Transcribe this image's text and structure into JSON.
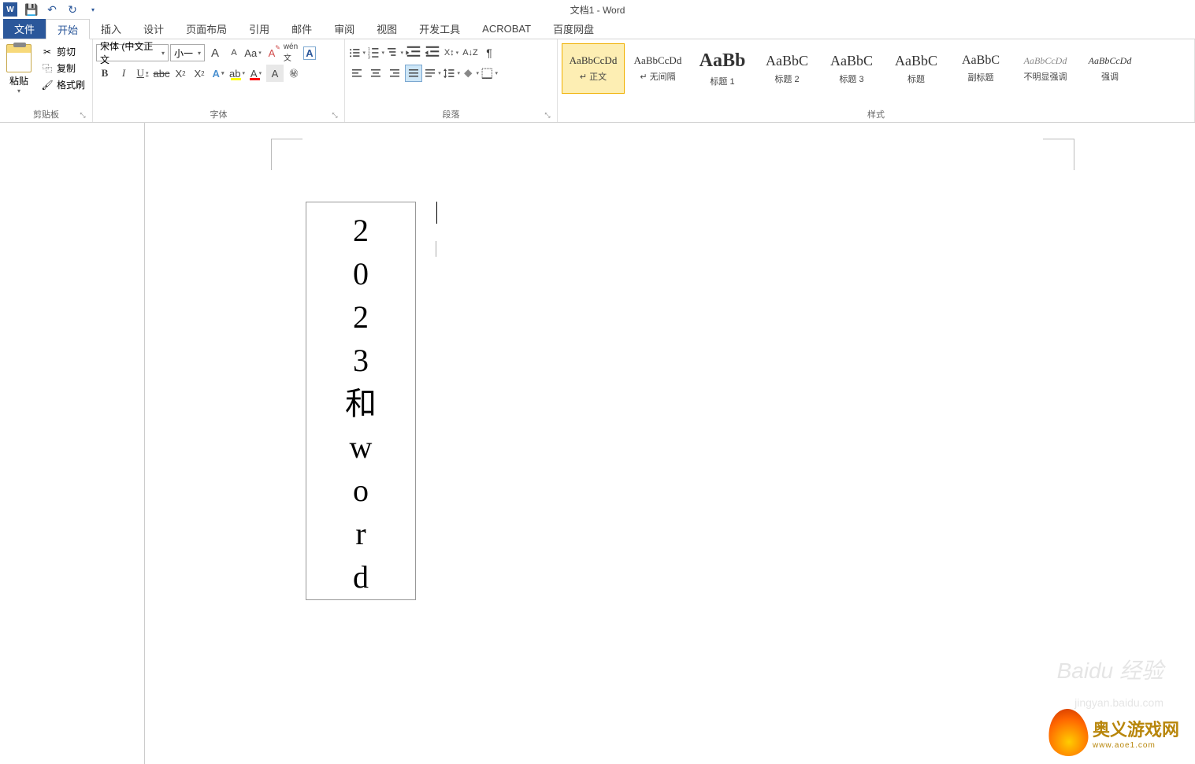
{
  "title": "文档1 - Word",
  "qat": {
    "save_icon": "💾",
    "undo_icon": "↶",
    "redo_icon": "↻"
  },
  "tabs": {
    "file": "文件",
    "items": [
      "开始",
      "插入",
      "设计",
      "页面布局",
      "引用",
      "邮件",
      "审阅",
      "视图",
      "开发工具",
      "ACROBAT",
      "百度网盘"
    ],
    "active": 0
  },
  "clipboard": {
    "paste": "粘贴",
    "cut": "剪切",
    "copy": "复制",
    "format_painter": "格式刷",
    "group_label": "剪贴板"
  },
  "font": {
    "name": "宋体 (中文正文",
    "size": "小一",
    "group_label": "字体",
    "grow": "A",
    "shrink": "A",
    "case": "Aa",
    "clear": "A",
    "phonetic": "拼",
    "border_char": "A",
    "bold": "B",
    "italic": "I",
    "underline": "U",
    "strike": "abc",
    "sub_x": "X",
    "sup_x": "X",
    "effects": "A",
    "highlight": "ab",
    "font_color": "A",
    "char_shading": "A",
    "enclose": "包"
  },
  "paragraph": {
    "group_label": "段落"
  },
  "styles": {
    "group_label": "样式",
    "items": [
      {
        "preview": "AaBbCcDd",
        "name": "↵ 正文",
        "size": "13px",
        "selected": true
      },
      {
        "preview": "AaBbCcDd",
        "name": "↵ 无间隔",
        "size": "13px"
      },
      {
        "preview": "AaBb",
        "name": "标题 1",
        "size": "24px",
        "weight": "bold"
      },
      {
        "preview": "AaBbC",
        "name": "标题 2",
        "size": "18px"
      },
      {
        "preview": "AaBbC",
        "name": "标题 3",
        "size": "18px"
      },
      {
        "preview": "AaBbC",
        "name": "标题",
        "size": "18px"
      },
      {
        "preview": "AaBbC",
        "name": "副标题",
        "size": "16px"
      },
      {
        "preview": "AaBbCcDd",
        "name": "不明显强调",
        "size": "12px",
        "style": "italic",
        "color": "#888"
      },
      {
        "preview": "AaBbCcDd",
        "name": "强调",
        "size": "12px",
        "style": "italic"
      }
    ]
  },
  "document": {
    "text_box_chars": [
      "2",
      "0",
      "2",
      "3",
      "和",
      "w",
      "o",
      "r",
      "d"
    ]
  },
  "watermark": {
    "brand": "Baidu 经验",
    "url": "jingyan.baidu.com",
    "site_cn": "奥义游戏网",
    "site_en": "www.aoe1.com"
  }
}
